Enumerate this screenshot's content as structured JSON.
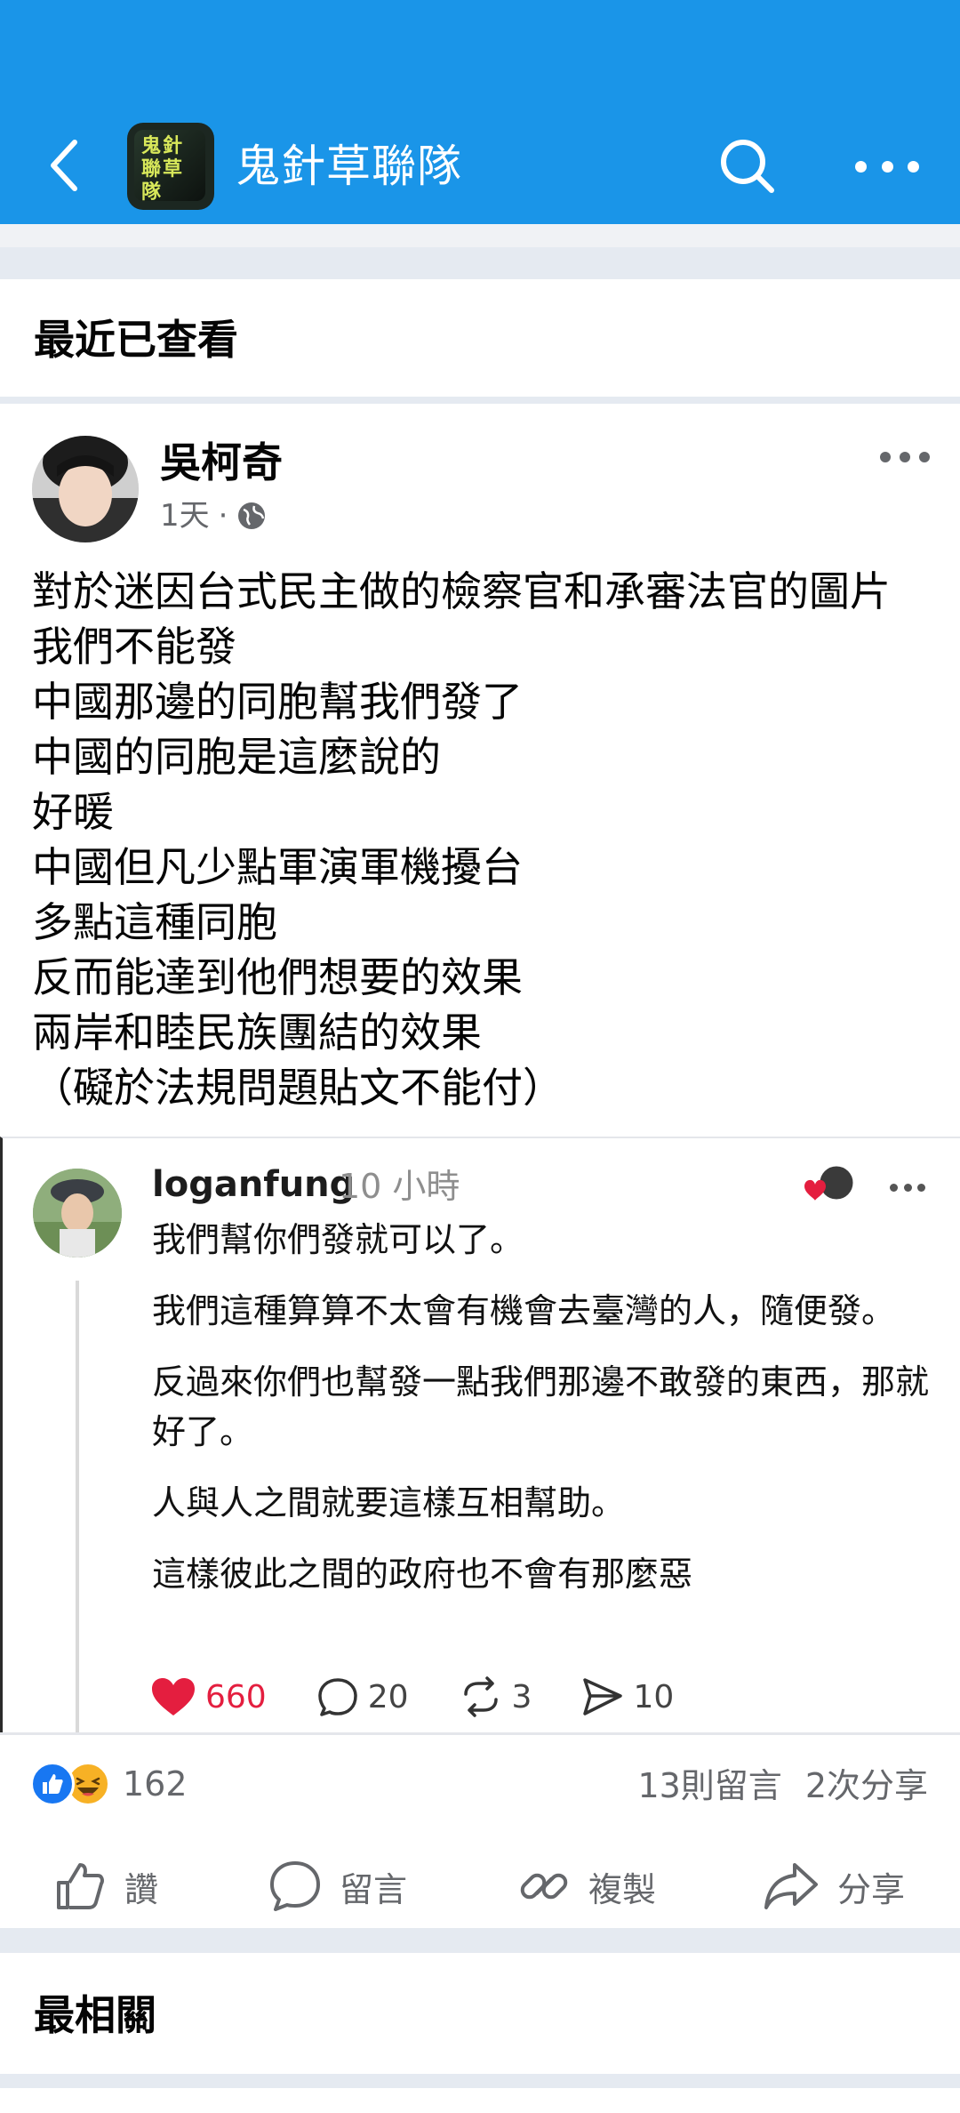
{
  "header": {
    "group_title": "鬼針草聯隊",
    "group_avatar_text": "鬼針聯草隊"
  },
  "sections": {
    "recent": "最近已查看",
    "relevant": "最相關"
  },
  "post": {
    "author": "吳柯奇",
    "time": "1天",
    "separator": "·",
    "lines": [
      "對於迷因台式民主做的檢察官和承審法官的圖片",
      "我們不能發",
      "中國那邊的同胞幫我們發了",
      "中國的同胞是這麼說的",
      "好暖",
      "中國但凡少點軍演軍機擾台",
      "多點這種同胞",
      "反而能達到他們想要的效果",
      "兩岸和睦民族團結的效果",
      "（礙於法規問題貼文不能付）"
    ],
    "reaction_count": "162",
    "comments_count": "13則留言",
    "shares_count": "2次分享"
  },
  "embedded_comment": {
    "username": "loganfung",
    "time": "10 小時",
    "paragraphs": [
      "我們幫你們發就可以了。",
      "我們這種算算不太會有機會去臺灣的人，隨便發。",
      "反過來你們也幫發一點我們那邊不敢發的東西，那就好了。",
      "人與人之間就要這樣互相幫助。",
      "這樣彼此之間的政府也不會有那麼惡"
    ],
    "likes": "660",
    "replies": "20",
    "reposts": "3",
    "shares": "10"
  },
  "actions": {
    "like": "讚",
    "comment": "留言",
    "copy": "複製",
    "share": "分享"
  },
  "colors": {
    "header_bg": "#1a95e8",
    "like_red": "#e41e3f",
    "like_blue": "#1877f2",
    "meta_gray": "#65676b"
  }
}
